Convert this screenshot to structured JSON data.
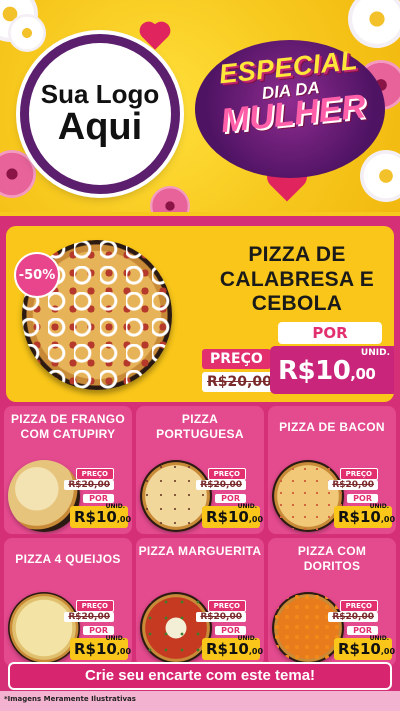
{
  "header": {
    "logo_line1": "Sua Logo",
    "logo_line2": "Aqui",
    "badge_line1": "ESPECIAL",
    "badge_line2": "DIA DA",
    "badge_line3": "MULHER"
  },
  "featured": {
    "discount": "-50%",
    "title": "PIZZA DE CALABRESA E CEBOLA",
    "preco_label": "PREÇO",
    "old_price": "R$20,00",
    "por_label": "POR",
    "unid_label": "UNID.",
    "price_main": "R$10",
    "price_cents": ",00"
  },
  "products": [
    {
      "name": "PIZZA DE FRANGO COM CATUPIRY",
      "preco_label": "PREÇO",
      "old_price": "R$20,00",
      "por_label": "POR",
      "unid_label": "UNID.",
      "price_main": "R$10",
      "price_cents": ",00"
    },
    {
      "name": "PIZZA PORTUGUESA",
      "preco_label": "PREÇO",
      "old_price": "R$20,00",
      "por_label": "POR",
      "unid_label": "UNID.",
      "price_main": "R$10",
      "price_cents": ",00"
    },
    {
      "name": "PIZZA DE BACON",
      "preco_label": "PREÇO",
      "old_price": "R$20,00",
      "por_label": "POR",
      "unid_label": "UNID.",
      "price_main": "R$10",
      "price_cents": ",00"
    },
    {
      "name": "PIZZA 4 QUEIJOS",
      "preco_label": "PREÇO",
      "old_price": "R$20,00",
      "por_label": "POR",
      "unid_label": "UNID.",
      "price_main": "R$10",
      "price_cents": ",00"
    },
    {
      "name": "PIZZA MARGUERITA",
      "preco_label": "PREÇO",
      "old_price": "R$20,00",
      "por_label": "POR",
      "unid_label": "UNID.",
      "price_main": "R$10",
      "price_cents": ",00"
    },
    {
      "name": "PIZZA COM DORITOS",
      "preco_label": "PREÇO",
      "old_price": "R$20,00",
      "por_label": "POR",
      "unid_label": "UNID.",
      "price_main": "R$10",
      "price_cents": ",00"
    }
  ],
  "cta": {
    "label": "Crie seu encarte com este tema!"
  },
  "footer": {
    "note": "*Imagens Meramente Ilustrativas"
  },
  "colors": {
    "accent": "#d42f77",
    "yellow": "#f9c619",
    "purple": "#5b1f6e"
  }
}
